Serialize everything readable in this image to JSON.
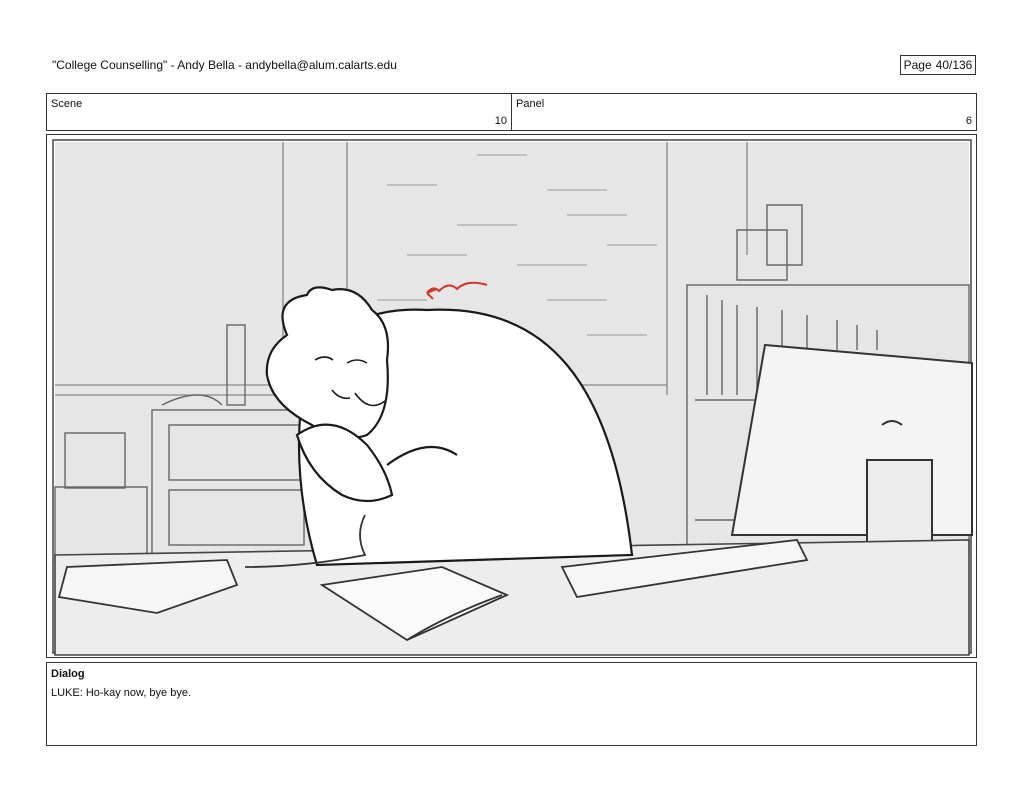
{
  "header": {
    "title": "\"College Counselling\"  -  Andy Bella  -   andybella@alum.calarts.edu",
    "page_label": "Page",
    "page_value": "40/136"
  },
  "scene": {
    "label": "Scene",
    "value": "10"
  },
  "panel": {
    "label": "Panel",
    "value": "6"
  },
  "dialog": {
    "label": "Dialog",
    "text": "LUKE: Ho-kay now, bye bye."
  },
  "colors": {
    "sketch": "#2a2a2a",
    "accent": "#d9342b",
    "wall": "#e6e6e6"
  }
}
